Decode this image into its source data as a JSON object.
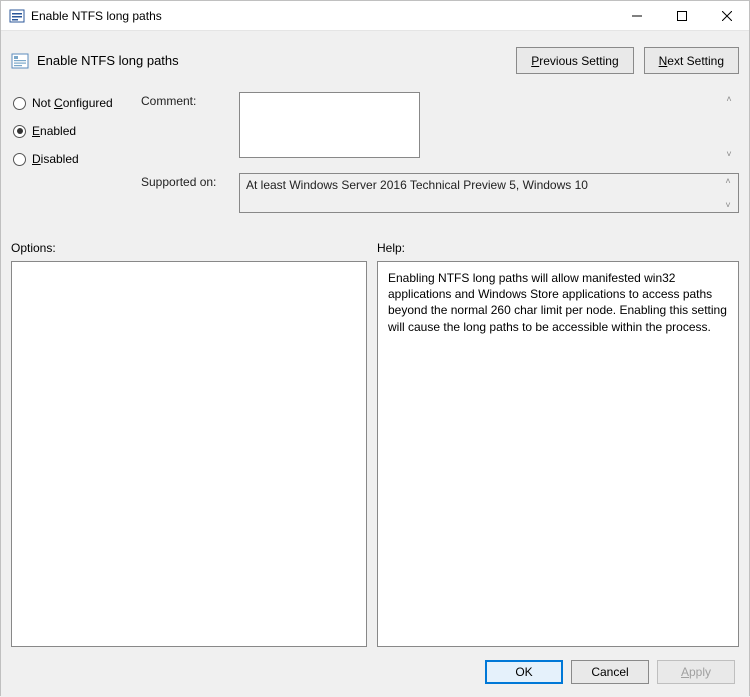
{
  "window": {
    "title": "Enable NTFS long paths"
  },
  "heading": "Enable NTFS long paths",
  "nav": {
    "previous": "Previous Setting",
    "next": "Next Setting"
  },
  "radios": {
    "not_configured": "Not Configured",
    "enabled": "Enabled",
    "disabled": "Disabled",
    "selected": "enabled"
  },
  "fields": {
    "comment_label": "Comment:",
    "comment_value": "",
    "supported_label": "Supported on:",
    "supported_value": "At least Windows Server 2016 Technical Preview 5, Windows 10"
  },
  "sections": {
    "options_label": "Options:",
    "help_label": "Help:",
    "help_text": "Enabling NTFS long paths will allow manifested win32 applications and Windows Store applications to access paths beyond the normal 260 char limit per node.  Enabling this setting will cause the long paths to be accessible within the process."
  },
  "buttons": {
    "ok": "OK",
    "cancel": "Cancel",
    "apply": "Apply"
  }
}
